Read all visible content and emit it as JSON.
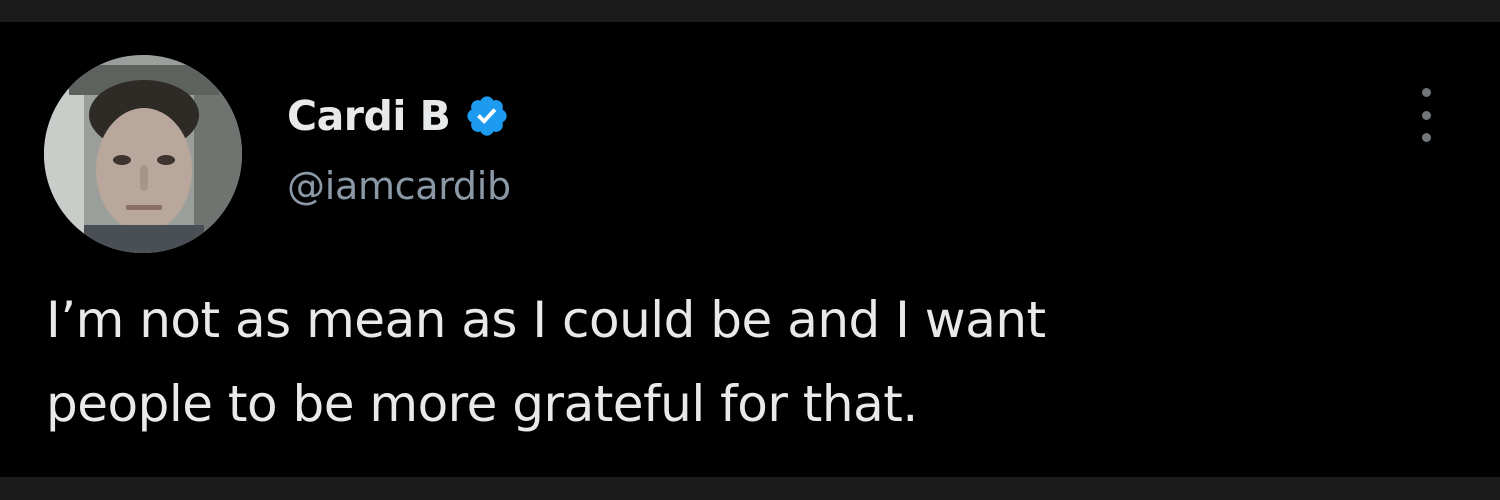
{
  "tweet": {
    "author": {
      "display_name": "Cardi B",
      "handle": "@iamcardib",
      "verified": true,
      "verified_badge_icon": "verified-badge-icon",
      "avatar": "profile-photo"
    },
    "text": "I’m not as mean as I could be and I want\npeople to be more grateful for that.",
    "menu_icon": "more-options-icon"
  },
  "colors": {
    "background": "#000000",
    "frame": "#1b1b1b",
    "primary_text": "#e7e9ea",
    "secondary_text": "#8b98a5",
    "verified_blue": "#1d9bf0"
  }
}
